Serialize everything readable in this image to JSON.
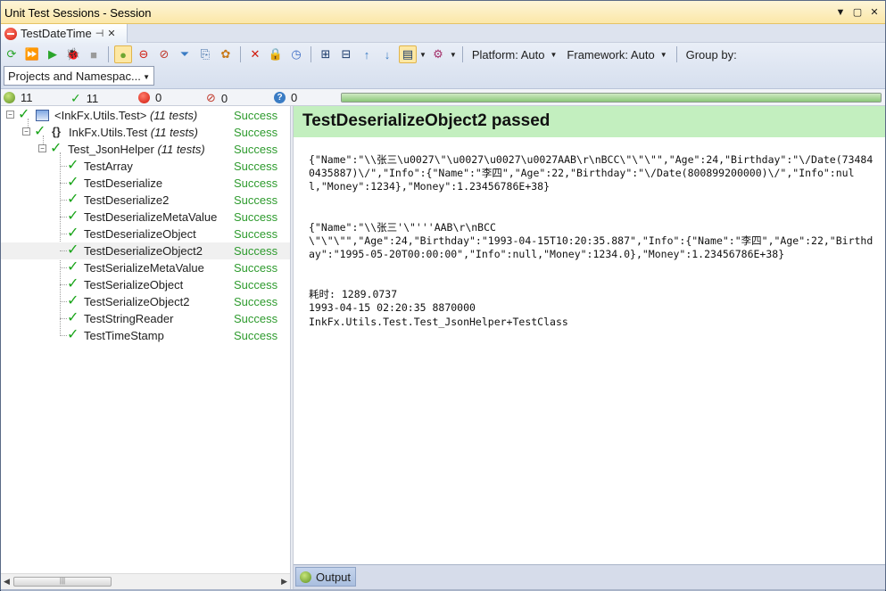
{
  "window": {
    "title": "Unit Test Sessions - Session"
  },
  "doc_tab": {
    "label": "TestDateTime"
  },
  "toolbar": {
    "platform_label": "Platform: Auto",
    "framework_label": "Framework: Auto",
    "group_by_label": "Group by:",
    "group_by_value": "Projects and Namespac..."
  },
  "counts": {
    "total": "11",
    "passed": "11",
    "failed": "0",
    "ignored": "0",
    "unknown": "0",
    "progress_fraction": 1.0
  },
  "tree": {
    "project": {
      "name": "<InkFx.Utils.Test>",
      "count": "(11 tests)",
      "status": "Success"
    },
    "namespace": {
      "name": "InkFx.Utils.Test",
      "count": "(11 tests)",
      "status": "Success",
      "icon_text": "{}"
    },
    "fixture": {
      "name": "Test_JsonHelper",
      "count": "(11 tests)",
      "status": "Success"
    },
    "tests": [
      {
        "name": "TestArray",
        "status": "Success"
      },
      {
        "name": "TestDeserialize",
        "status": "Success"
      },
      {
        "name": "TestDeserialize2",
        "status": "Success"
      },
      {
        "name": "TestDeserializeMetaValue",
        "status": "Success"
      },
      {
        "name": "TestDeserializeObject",
        "status": "Success"
      },
      {
        "name": "TestDeserializeObject2",
        "status": "Success"
      },
      {
        "name": "TestSerializeMetaValue",
        "status": "Success"
      },
      {
        "name": "TestSerializeObject",
        "status": "Success"
      },
      {
        "name": "TestSerializeObject2",
        "status": "Success"
      },
      {
        "name": "TestStringReader",
        "status": "Success"
      },
      {
        "name": "TestTimeStamp",
        "status": "Success"
      }
    ]
  },
  "details": {
    "banner": "TestDeserializeObject2 passed",
    "output_lines": [
      "{\"Name\":\"\\\\张三\\u0027\\\"\\u0027\\u0027\\u0027AAB\\r\\nBCC\\\"\\\"\\\"\",\"Age\":24,\"Birthday\":\"\\/Date(734840435887)\\/\",\"Info\":{\"Name\":\"李四\",\"Age\":22,\"Birthday\":\"\\/Date(800899200000)\\/\",\"Info\":null,\"Money\":1234},\"Money\":1.23456786E+38}",
      "{\"Name\":\"\\\\张三'\\\"'''AAB\\r\\nBCC",
      "\\\"\\\"\\\"\",\"Age\":24,\"Birthday\":\"1993-04-15T10:20:35.887\",\"Info\":{\"Name\":\"李四\",\"Age\":22,\"Birthday\":\"1995-05-20T00:00:00\",\"Info\":null,\"Money\":1234.0},\"Money\":1.23456786E+38}",
      "耗时: 1289.0737",
      "1993-04-15 02:20:35 8870000",
      "InkFx.Utils.Test.Test_JsonHelper+TestClass"
    ]
  },
  "bottom": {
    "output_tab": "Output"
  },
  "colors": {
    "success": "#2e9b2e",
    "banner_bg": "#c3efbf",
    "title_bg": "#fbe7a8"
  }
}
